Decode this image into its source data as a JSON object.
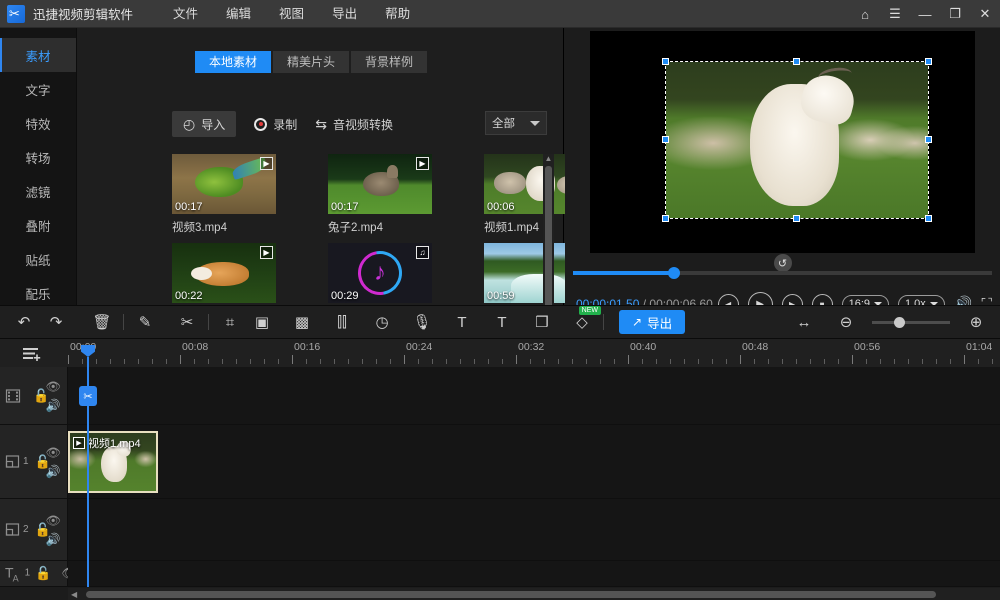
{
  "titlebar": {
    "app_title": "迅捷视频剪辑软件",
    "logo_icon": "scissors-logo-icon",
    "menus": [
      "文件",
      "编辑",
      "视图",
      "导出",
      "帮助"
    ],
    "window_buttons": [
      {
        "name": "home",
        "glyph": "⌂"
      },
      {
        "name": "menu",
        "glyph": "☰"
      },
      {
        "name": "minimize",
        "glyph": "—"
      },
      {
        "name": "maximize",
        "glyph": "❐"
      },
      {
        "name": "close",
        "glyph": "✕"
      }
    ]
  },
  "sidebar": {
    "items": [
      {
        "label": "素材",
        "active": true
      },
      {
        "label": "文字",
        "active": false
      },
      {
        "label": "特效",
        "active": false
      },
      {
        "label": "转场",
        "active": false
      },
      {
        "label": "滤镜",
        "active": false
      },
      {
        "label": "叠附",
        "active": false
      },
      {
        "label": "贴纸",
        "active": false
      },
      {
        "label": "配乐",
        "active": false
      }
    ]
  },
  "media_panel": {
    "tabs": [
      {
        "label": "本地素材",
        "active": true
      },
      {
        "label": "精美片头",
        "active": false
      },
      {
        "label": "背景样例",
        "active": false
      }
    ],
    "import_label": "导入",
    "record_label": "录制",
    "convert_label": "音视频转换",
    "filter_value": "全部",
    "items": [
      {
        "name": "视频3.mp4",
        "duration": "00:17",
        "kind": "video"
      },
      {
        "name": "兔子2.mp4",
        "duration": "00:17",
        "kind": "video"
      },
      {
        "name": "视频1.mp4",
        "duration": "00:06",
        "kind": "video"
      },
      {
        "name": "",
        "duration": "00:22",
        "kind": "video"
      },
      {
        "name": "",
        "duration": "00:29",
        "kind": "audio"
      },
      {
        "name": "",
        "duration": "00:59",
        "kind": "video"
      }
    ]
  },
  "preview": {
    "current_time": "00:00:01.50",
    "separator": " / ",
    "total_time": "00:00:06.60",
    "aspect_ratio": "16:9",
    "playback_speed": "1.0x",
    "progress_percent": 24,
    "controls": [
      {
        "name": "prev-frame-button",
        "glyph": "◀"
      },
      {
        "name": "play-button",
        "glyph": "▶"
      },
      {
        "name": "next-frame-button",
        "glyph": "▶"
      },
      {
        "name": "stop-button",
        "glyph": "■"
      }
    ],
    "volume_icon": "🔊",
    "fullscreen_icon": "⛶",
    "rotate_handle_icon": "↺"
  },
  "toolbar": {
    "icons": [
      {
        "name": "undo-icon",
        "glyph": "↶"
      },
      {
        "name": "redo-icon",
        "glyph": "↷"
      },
      {
        "name": "delete-icon",
        "glyph": "🗑"
      },
      {
        "name": "edit-icon",
        "glyph": "✎"
      },
      {
        "name": "cut-icon",
        "glyph": "✂"
      },
      {
        "name": "crop-icon",
        "glyph": "⌗"
      },
      {
        "name": "canvas-icon",
        "glyph": "▣"
      },
      {
        "name": "mosaic-icon",
        "glyph": "▩"
      },
      {
        "name": "audio-wave-icon",
        "glyph": "⫿⫿"
      },
      {
        "name": "speed-clock-icon",
        "glyph": "◷"
      },
      {
        "name": "microphone-icon",
        "glyph": "🎙"
      },
      {
        "name": "text-to-speech-icon",
        "glyph": "T"
      },
      {
        "name": "speech-to-text-icon",
        "glyph": "T"
      },
      {
        "name": "picture-in-picture-icon",
        "glyph": "❒"
      },
      {
        "name": "watermark-tag-icon",
        "glyph": "◇"
      }
    ],
    "new_badge": "NEW",
    "export_label": "导出",
    "export_icon": "export-icon",
    "fit-window_icon": "↔",
    "zoom_out_icon": "⊖",
    "zoom_in_icon": "⊕",
    "zoom_value": 28
  },
  "timeline": {
    "add_track_icon": "add-track-icon",
    "ruler_labels": [
      "00:00",
      "00:08",
      "00:16",
      "00:24",
      "00:32",
      "00:40",
      "00:48",
      "00:56",
      "01:04"
    ],
    "playhead_icon": "✂",
    "tracks": [
      {
        "id": "main-video",
        "icon": "film-icon",
        "number": "",
        "type": "video"
      },
      {
        "id": "pip-1",
        "icon": "pip-icon",
        "number": "1",
        "type": "video"
      },
      {
        "id": "pip-2",
        "icon": "pip-icon",
        "number": "2",
        "type": "video"
      },
      {
        "id": "text-1",
        "icon": "text-icon",
        "number": "1",
        "type": "text"
      }
    ],
    "clip": {
      "label": "视频1.mp4",
      "track": "pip-1",
      "badge_icon": "video-badge-icon"
    }
  },
  "colors": {
    "accent": "#1f8bf5",
    "titlebar_bg": "#3a3a3a",
    "panel_bg": "#1e1e1e",
    "sidebar_bg": "#141414",
    "timeline_bg": "#151515",
    "clip_border": "#e8dfc0",
    "new_badge": "#22b14c"
  }
}
